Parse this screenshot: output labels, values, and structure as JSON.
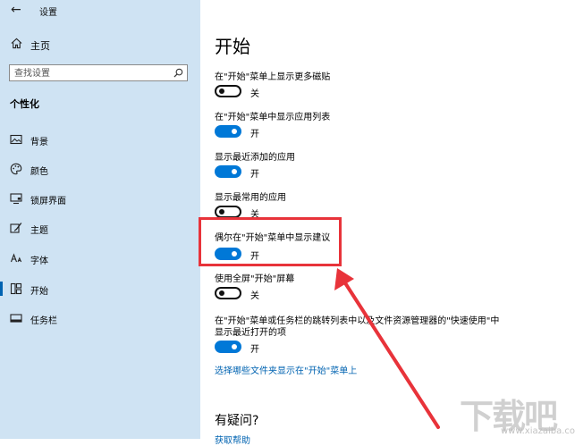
{
  "window": {
    "back_glyph": "←",
    "title": "设置"
  },
  "sidebar": {
    "home_label": "主页",
    "search_placeholder": "查找设置",
    "section_heading": "个性化",
    "items": [
      {
        "label": "背景",
        "icon": "picture-icon",
        "active": false
      },
      {
        "label": "颜色",
        "icon": "palette-icon",
        "active": false
      },
      {
        "label": "锁屏界面",
        "icon": "lock-screen-icon",
        "active": false
      },
      {
        "label": "主题",
        "icon": "brush-icon",
        "active": false
      },
      {
        "label": "字体",
        "icon": "font-icon",
        "active": false
      },
      {
        "label": "开始",
        "icon": "start-icon",
        "active": true
      },
      {
        "label": "任务栏",
        "icon": "taskbar-icon",
        "active": false
      }
    ]
  },
  "main": {
    "page_title": "开始",
    "settings": [
      {
        "label": "在\"开始\"菜单上显示更多磁贴",
        "state": "关",
        "on": false
      },
      {
        "label": "在\"开始\"菜单中显示应用列表",
        "state": "开",
        "on": true
      },
      {
        "label": "显示最近添加的应用",
        "state": "开",
        "on": true
      },
      {
        "label": "显示最常用的应用",
        "state": "关",
        "on": false
      },
      {
        "label": "偶尔在\"开始\"菜单中显示建议",
        "state": "开",
        "on": true
      },
      {
        "label": "使用全屏\"开始\"屏幕",
        "state": "关",
        "on": false
      },
      {
        "label": "在\"开始\"菜单或任务栏的跳转列表中以及文件资源管理器的\"快速使用\"中",
        "label_line2": "显示最近打开的项",
        "state": "开",
        "on": true
      }
    ],
    "link_folders": "选择哪些文件夹显示在\"开始\"菜单上",
    "question_heading": "有疑问?",
    "help_link": "获取帮助"
  },
  "overlay": {
    "highlight_color": "#e8333a",
    "arrow_color": "#e8333a"
  },
  "watermark": {
    "main": "下载吧",
    "sub": "www.xiazaiba.com"
  },
  "colors": {
    "sidebar_bg": "#cfe3f3",
    "accent": "#0078d7",
    "link": "#0063b1"
  }
}
